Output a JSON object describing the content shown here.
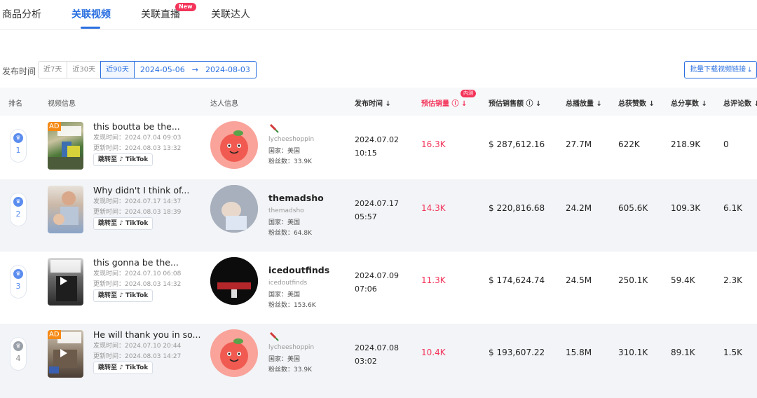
{
  "tabs": [
    {
      "label": "商品分析",
      "active": false
    },
    {
      "label": "关联视频",
      "active": true
    },
    {
      "label": "关联直播",
      "active": false,
      "badge": "New"
    },
    {
      "label": "关联达人",
      "active": false
    }
  ],
  "filter": {
    "label": "发布时间",
    "ranges": [
      "近7天",
      "近30天",
      "近90天"
    ],
    "selected_range": "近90天",
    "date_start": "2024-05-06",
    "date_arrow": "→",
    "date_end": "2024-08-03",
    "download_label": "批量下载视频链接 ⤓"
  },
  "table": {
    "headers": {
      "rank": "排名",
      "video": "视频信息",
      "creator": "达人信息",
      "publish": "发布时间 ↓",
      "est_sales": "预估销量 ⓘ ↓",
      "est_sales_badge": "内测",
      "est_revenue": "预估销售额 ⓘ ↓",
      "plays": "总播放量 ↓",
      "likes": "总获赞数 ↓",
      "shares": "总分享数 ↓",
      "comments": "总评论数 ↓"
    },
    "rows": [
      {
        "rank": "1",
        "title": "this boutta be the...",
        "found": "发现时间：2024.07.04 09:03",
        "updated": "更新时间：2024.08.03 13:32",
        "tiktok": "跳转至 ♪ TikTok",
        "ad": "AD",
        "creator_name": "",
        "creator_handle": "lycheeshoppin",
        "country": "国家：美国",
        "fans": "粉丝数：33.9K",
        "pub_date": "2024.07.02",
        "pub_time": "10:15",
        "est_sales": "16.3K",
        "est_revenue": "$ 287,612.16",
        "plays": "27.7M",
        "likes": "622K",
        "shares": "218.9K",
        "comments": "0"
      },
      {
        "rank": "2",
        "title": "Why didn't I think of...",
        "found": "发现时间：2024.07.17 14:37",
        "updated": "更新时间：2024.08.03 18:39",
        "tiktok": "跳转至 ♪ TikTok",
        "ad": "",
        "creator_name": "themadsho",
        "creator_handle": "themadsho",
        "country": "国家：美国",
        "fans": "粉丝数：64.8K",
        "pub_date": "2024.07.17",
        "pub_time": "05:57",
        "est_sales": "14.3K",
        "est_revenue": "$ 220,816.68",
        "plays": "24.2M",
        "likes": "605.6K",
        "shares": "109.3K",
        "comments": "6.1K"
      },
      {
        "rank": "3",
        "title": "this gonna be the...",
        "found": "发现时间：2024.07.10 06:08",
        "updated": "更新时间：2024.08.03 14:32",
        "tiktok": "跳转至 ♪ TikTok",
        "ad": "",
        "creator_name": "icedoutfinds",
        "creator_handle": "icedoutfinds",
        "country": "国家：美国",
        "fans": "粉丝数：153.6K",
        "pub_date": "2024.07.09",
        "pub_time": "07:06",
        "est_sales": "11.3K",
        "est_revenue": "$ 174,624.74",
        "plays": "24.5M",
        "likes": "250.1K",
        "shares": "59.4K",
        "comments": "2.3K"
      },
      {
        "rank": "4",
        "title": "He will thank you in so...",
        "found": "发现时间：2024.07.10 20:44",
        "updated": "更新时间：2024.08.03 14:27",
        "tiktok": "跳转至 ♪ TikTok",
        "ad": "AD",
        "creator_name": "",
        "creator_handle": "lycheeshoppin",
        "country": "国家：美国",
        "fans": "粉丝数：33.9K",
        "pub_date": "2024.07.08",
        "pub_time": "03:02",
        "est_sales": "10.4K",
        "est_revenue": "$ 193,607.22",
        "plays": "15.8M",
        "likes": "310.1K",
        "shares": "89.1K",
        "comments": "1.5K"
      }
    ]
  },
  "colors": {
    "accent": "#2a6fe0",
    "highlight": "#f4345a",
    "ad_tag": "#f58a16"
  },
  "icons": {
    "rank_medal": "medal-icon",
    "sort": "sort-down-icon",
    "info": "info-icon",
    "download": "download-icon",
    "pin": "pin-icon"
  }
}
